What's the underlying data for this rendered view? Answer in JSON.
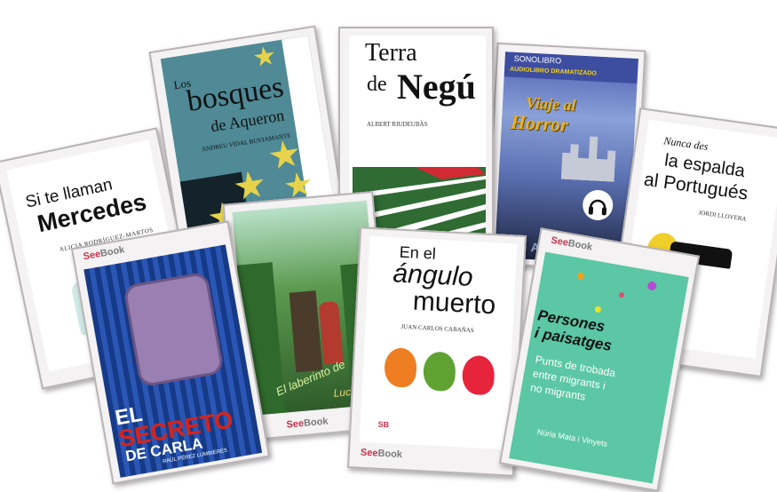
{
  "brand": {
    "see": "See",
    "book": "Book",
    "sonolibro": "SONOLIBRO",
    "sb": "SB"
  },
  "books": {
    "mercedes": {
      "title_line1": "Si te llaman",
      "title_line2": "Mercedes",
      "author": "ALICIA RODRÍGUEZ-MARTOS"
    },
    "bosques": {
      "title_line1": "Los",
      "title_line2": "bosques",
      "title_line3": "de Aqueron",
      "author": "ANDREU VIDAL BUSTAMANTE"
    },
    "terra": {
      "title_line1": "Terra",
      "title_line2": "de",
      "title_line3": "Negú",
      "author": "ALBERT RIUDEUBÀS"
    },
    "viaje": {
      "header": "AUDIOLIBRO DRAMATIZADO",
      "title_line1": "Viaje al",
      "title_line2": "Horror",
      "bottom": "ALP    LY"
    },
    "espalda": {
      "title_line1": "Nunca des",
      "title_line2": "la espalda",
      "title_line3": "al Portugués",
      "author": "JORDI LLOVERA"
    },
    "secreto": {
      "title_line1": "EL",
      "title_line2": "SECRETO",
      "title_line3": "DE CARLA",
      "author": "RAÚL PÉREZ LUMBIERES"
    },
    "laberinto": {
      "title_line1": "El laberinto de",
      "author": "Lucho V"
    },
    "angulo": {
      "title_line1": "En el",
      "title_line2": "ángulo",
      "title_line3": "muerto",
      "author": "JUAN CARLOS CABAÑAS"
    },
    "persones": {
      "title_line1": "Persones",
      "title_line2": "i paisatges",
      "sub1": "Punts de trobada",
      "sub2": "entre migrants i",
      "sub3": "no migrants",
      "author": "Núria Mata i Vinyets"
    }
  },
  "colors": {
    "see_red": "#c4334a",
    "book_gray": "#7a7a7a",
    "card_border": "#b9b3b6"
  }
}
